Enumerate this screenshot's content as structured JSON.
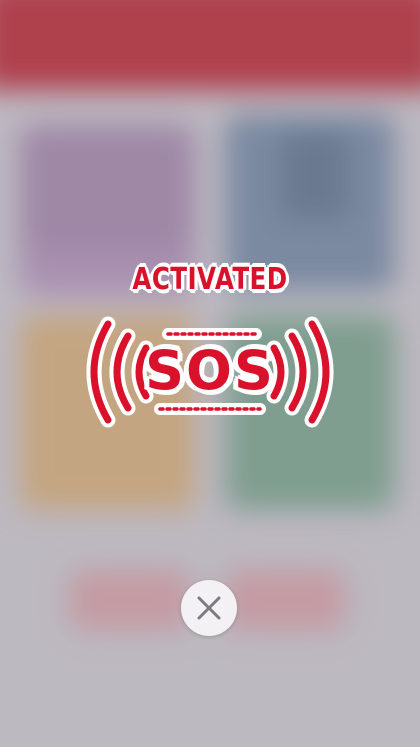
{
  "sos_alert": {
    "status_label": "ACTIVATED",
    "title": "SOS"
  },
  "controls": {
    "close_icon": "close-icon"
  },
  "colors": {
    "alert_red": "#d9112b",
    "outline_white": "#ffffff",
    "header_red": "#a8000f",
    "close_button_bg": "#f3f1f4",
    "close_icon_gray": "#7d7a80"
  }
}
